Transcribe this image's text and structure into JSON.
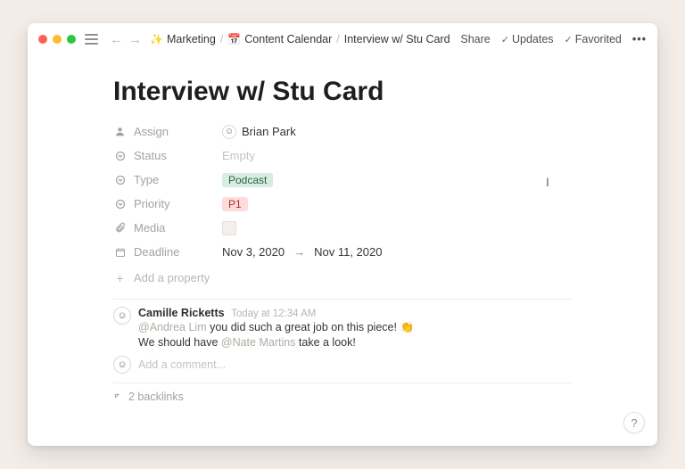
{
  "topbar": {
    "breadcrumbs": [
      {
        "emoji": "✨",
        "label": "Marketing"
      },
      {
        "emoji": "📅",
        "label": "Content Calendar"
      },
      {
        "emoji": "",
        "label": "Interview w/ Stu Card"
      }
    ],
    "share": "Share",
    "updates": "Updates",
    "favorited": "Favorited"
  },
  "page": {
    "title": "Interview w/ Stu Card"
  },
  "properties": {
    "assign": {
      "label": "Assign",
      "value": "Brian Park"
    },
    "status": {
      "label": "Status",
      "value": "Empty"
    },
    "type": {
      "label": "Type",
      "value": "Podcast"
    },
    "priority": {
      "label": "Priority",
      "value": "P1"
    },
    "media": {
      "label": "Media"
    },
    "deadline": {
      "label": "Deadline",
      "start": "Nov 3, 2020",
      "end": "Nov 11, 2020"
    },
    "add_property": "Add a property"
  },
  "comments": {
    "author": "Camille Ricketts",
    "time": "Today at 12:34 AM",
    "line1_mention": "@Andrea Lim",
    "line1_text": " you did such a great job on this piece! ",
    "line1_emoji": "👏",
    "line2_pre": "We should have ",
    "line2_mention": "@Nate Martins",
    "line2_post": " take a look!",
    "add_placeholder": "Add a comment..."
  },
  "backlinks": {
    "label": "2 backlinks"
  },
  "help": "?"
}
